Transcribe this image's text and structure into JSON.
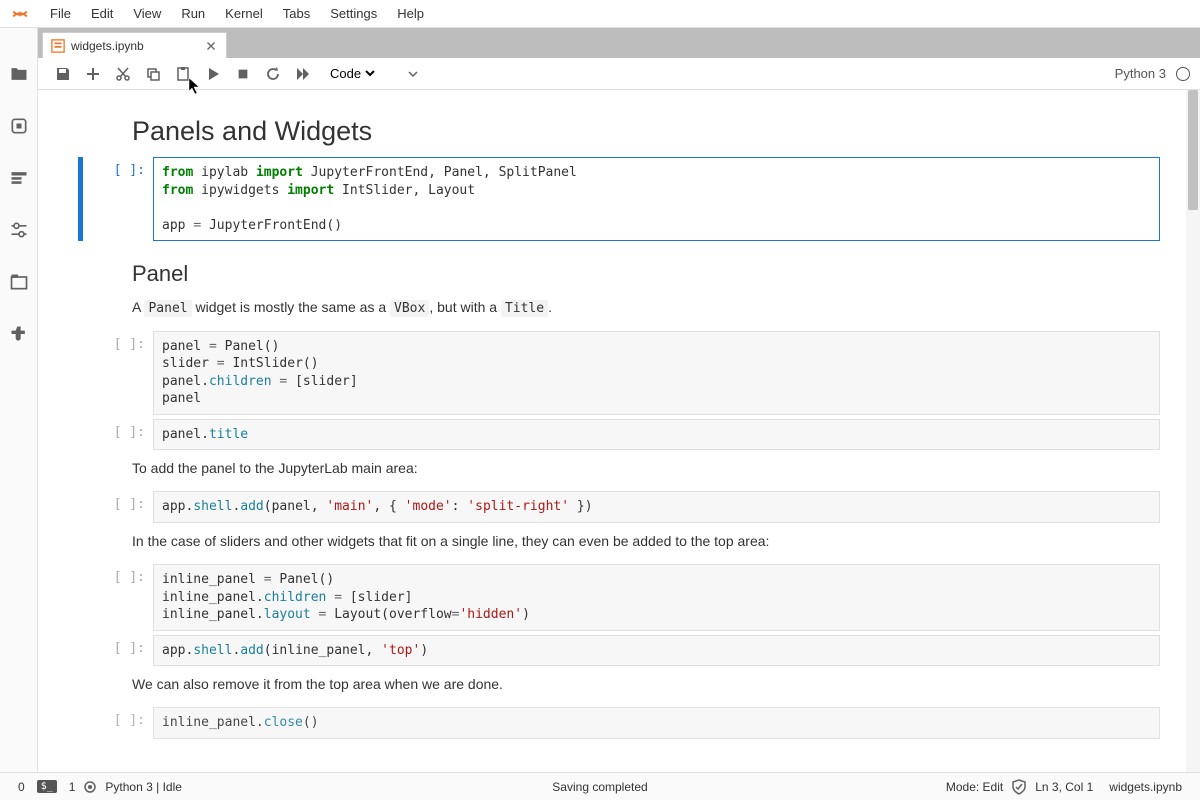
{
  "menu": {
    "items": [
      "File",
      "Edit",
      "View",
      "Run",
      "Kernel",
      "Tabs",
      "Settings",
      "Help"
    ]
  },
  "tab": {
    "title": "widgets.ipynb"
  },
  "toolbar": {
    "cell_type": "Code",
    "kernel": "Python 3"
  },
  "headings": {
    "h1": "Panels and Widgets",
    "h2_panel": "Panel"
  },
  "text": {
    "panel_desc_a": "A ",
    "panel_desc_b": " widget is mostly the same as a ",
    "panel_desc_c": ", but with a ",
    "panel_desc_d": ".",
    "panel_code": "Panel",
    "vbox_code": "VBox",
    "title_code": "Title",
    "add_main": "To add the panel to the JupyterLab main area:",
    "inline_desc": "In the case of sliders and other widgets that fit on a single line, they can even be added to the top area:",
    "remove_desc": "We can also remove it from the top area when we are done."
  },
  "prompts": {
    "empty": "[ ]:"
  },
  "status": {
    "terminals_0": "0",
    "terminals_1": "1",
    "kernel_state": "Python 3 | Idle",
    "save": "Saving completed",
    "mode": "Mode: Edit",
    "pos": "Ln 3, Col 1",
    "file": "widgets.ipynb"
  }
}
